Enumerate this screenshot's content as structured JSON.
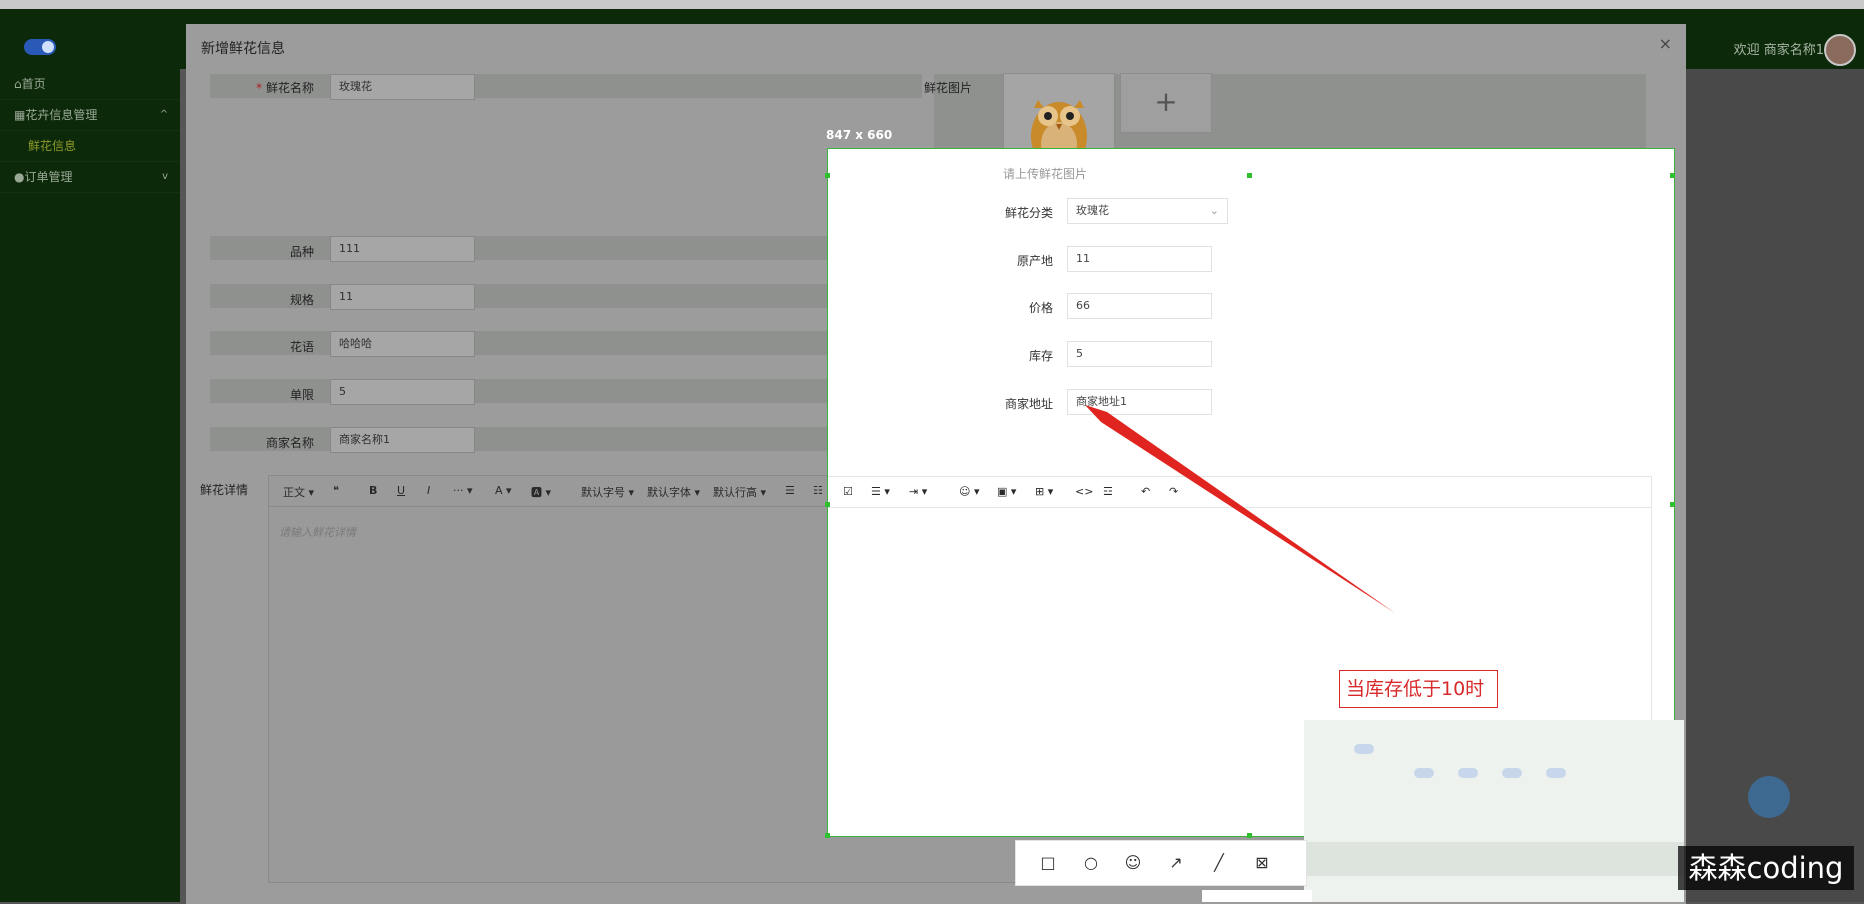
{
  "header": {
    "welcome": "欢迎 商家名称1"
  },
  "sidebar": {
    "items": [
      {
        "label": "⌂首页"
      },
      {
        "label": "▦花卉信息管理",
        "arrow": "^"
      },
      {
        "label": "鲜花信息"
      },
      {
        "label": "●订单管理",
        "arrow": "v"
      }
    ]
  },
  "dialog": {
    "title": "新增鲜花信息",
    "close": "×",
    "fields": {
      "name": {
        "label": "鲜花名称",
        "value": "玫瑰花"
      },
      "image": {
        "label": "鲜花图片",
        "hint": "请上传鲜花图片",
        "add": "+"
      },
      "variety": {
        "label": "品种",
        "value": "111"
      },
      "category": {
        "label": "鲜花分类",
        "value": "玫瑰花"
      },
      "spec": {
        "label": "规格",
        "value": "11"
      },
      "origin": {
        "label": "原产地",
        "value": "11"
      },
      "language": {
        "label": "花语",
        "value": "哈哈哈"
      },
      "price": {
        "label": "价格",
        "value": "66"
      },
      "limit": {
        "label": "单限",
        "value": "5"
      },
      "stock": {
        "label": "库存",
        "value": "5"
      },
      "merchant_name": {
        "label": "商家名称",
        "value": "商家名称1"
      },
      "merchant_address": {
        "label": "商家地址",
        "value": "商家地址1"
      },
      "detail": {
        "label": "鲜花详情",
        "placeholder": "请输入鲜花详情"
      }
    },
    "editor_toolbar": {
      "paragraph": "正文 ▾",
      "quote": "❝",
      "bold": "B",
      "underline": "U",
      "italic": "I",
      "more": "··· ▾",
      "font_color": "A ▾",
      "bg_color": "🅰 ▾",
      "font_size": "默认字号 ▾",
      "font_family": "默认字体 ▾",
      "line_height": "默认行高 ▾",
      "bullet_list": "☰",
      "numbered_list": "☷",
      "todo": "☑",
      "align": "☰ ▾",
      "indent": "⇥ ▾",
      "emoji": "☺ ▾",
      "image": "▣ ▾",
      "table": "⊞ ▾",
      "code": "<>",
      "divider": "☲",
      "undo": "↶",
      "redo": "↷"
    }
  },
  "capture": {
    "dimension_label": "847 x 660",
    "annotation": "当库存低于10时",
    "tools": [
      "□",
      "○",
      "☺",
      "↗",
      "╱",
      "⊠"
    ]
  },
  "watermark": "森森coding"
}
